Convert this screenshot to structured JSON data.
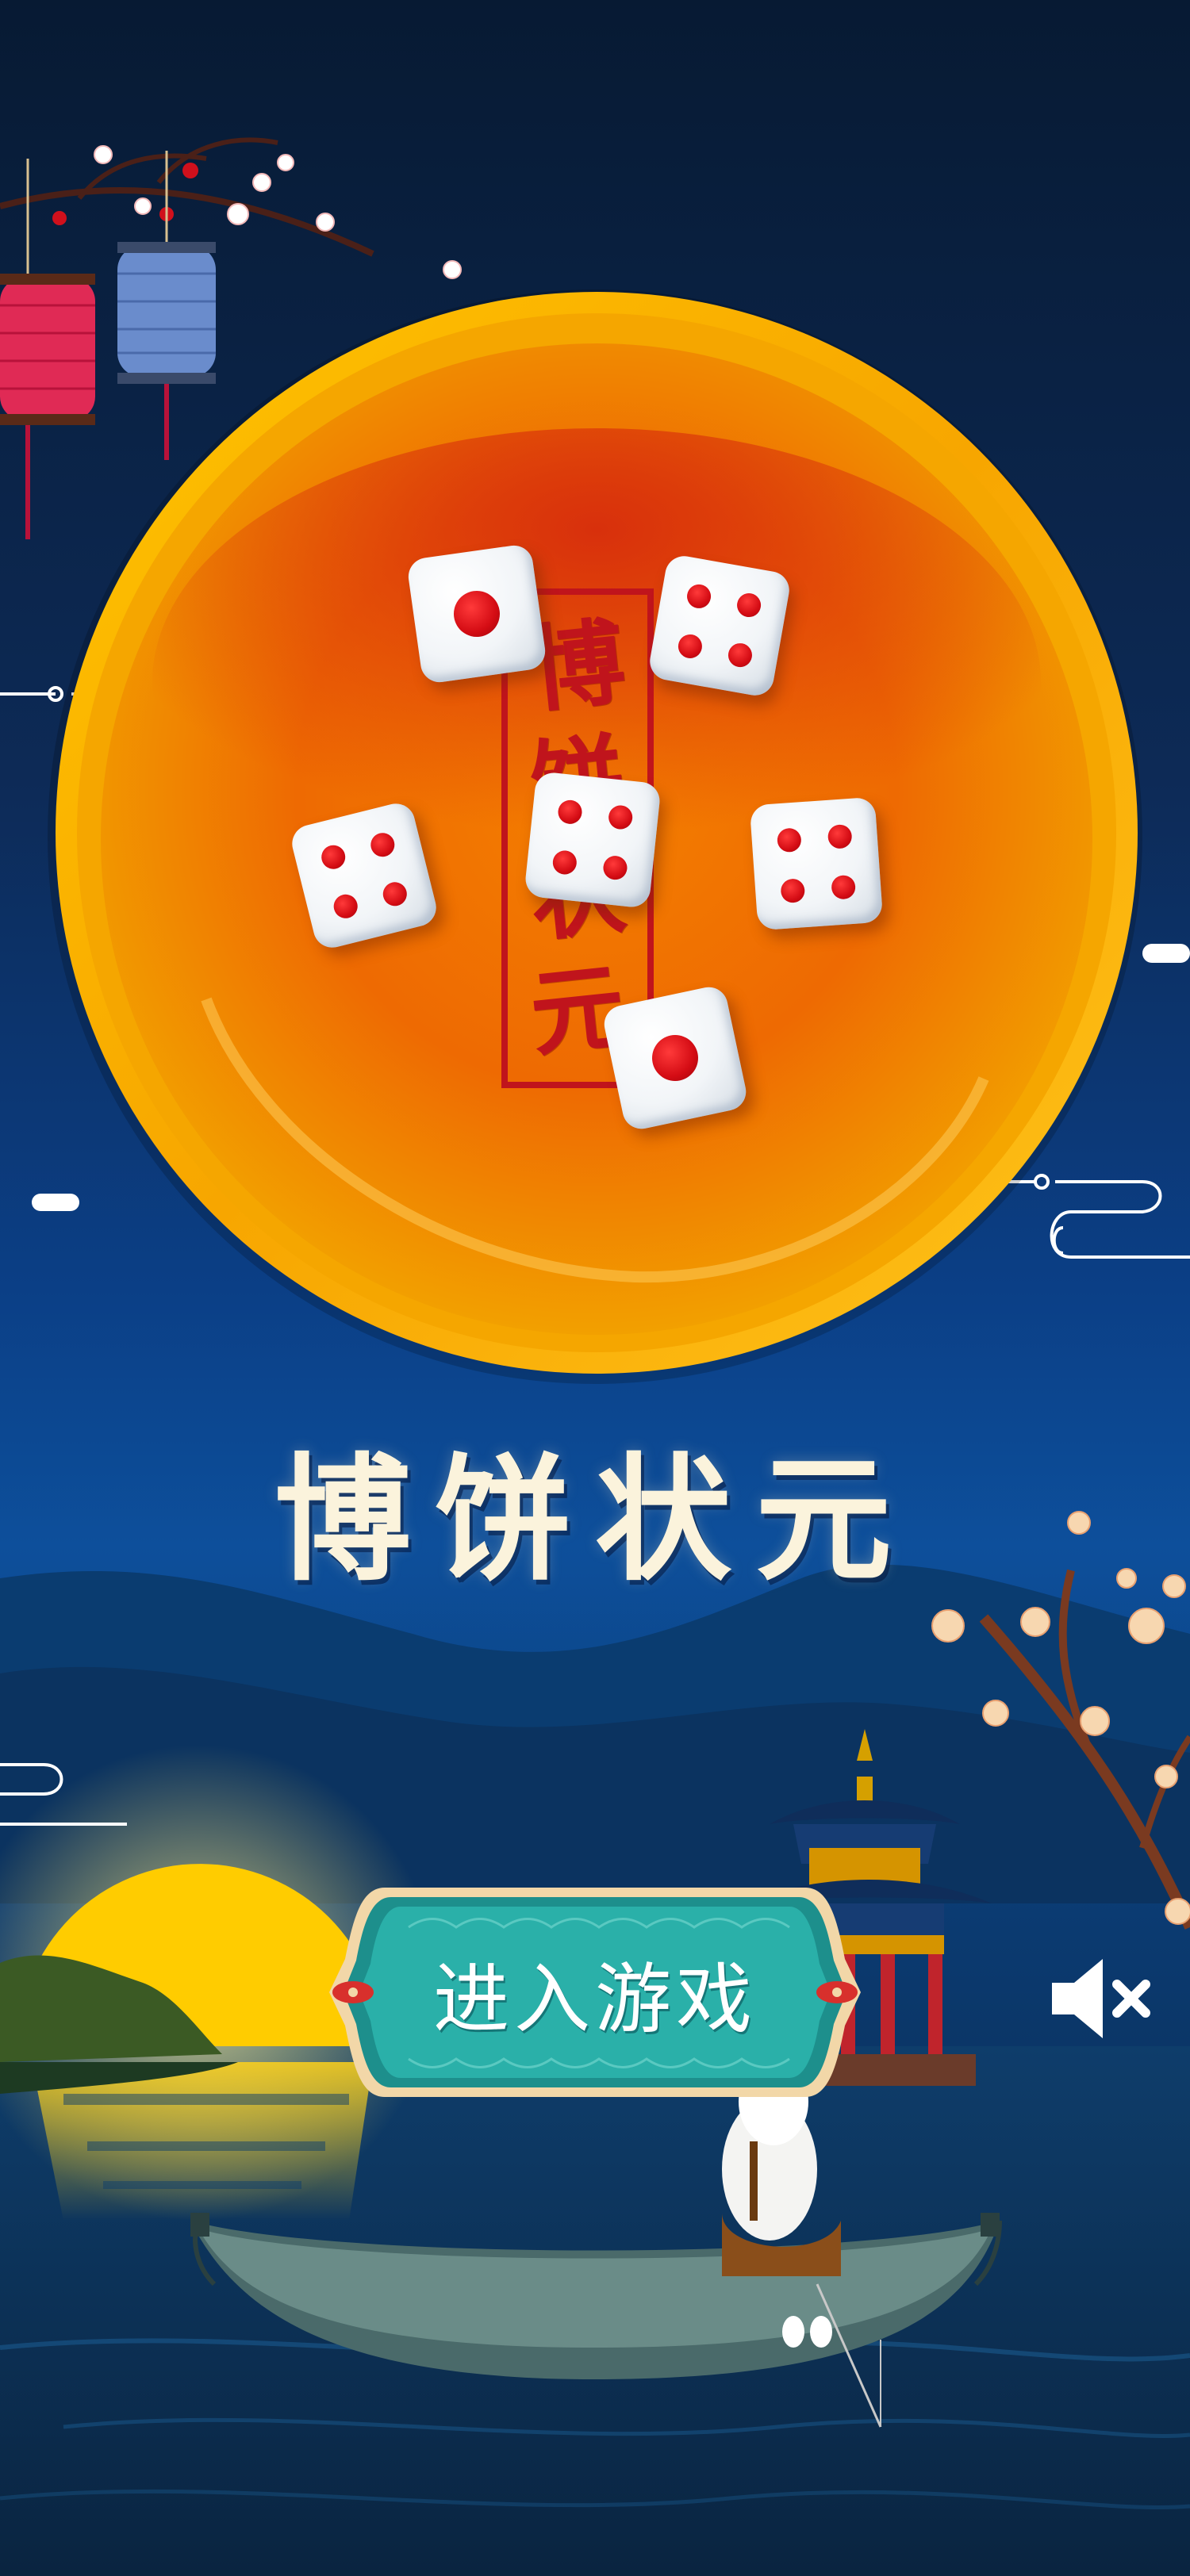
{
  "screen": {
    "title": "博饼状元"
  },
  "bowl": {
    "stamp_chars": [
      "博",
      "饼",
      "状",
      "元"
    ],
    "dice": [
      1,
      4,
      4,
      4,
      4,
      1
    ]
  },
  "menu": {
    "enter_label": "进入游戏",
    "sound_state": "muted"
  },
  "icons": {
    "sound": "speaker-muted-icon",
    "enter": "enter-game-button"
  },
  "colors": {
    "bowl_orange": "#f08a00",
    "bowl_rim": "#f7b700",
    "pip_red": "#d40c14",
    "button_teal": "#1d8f8c",
    "moon_yellow": "#ffcc00",
    "title_cream": "#fbf3dc"
  }
}
